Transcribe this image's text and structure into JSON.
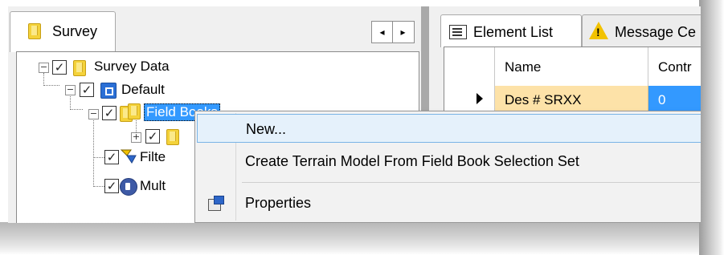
{
  "survey_panel": {
    "tab_label": "Survey",
    "scroll_left": "◂",
    "scroll_right": "▸",
    "tree": {
      "survey_data": "Survey Data",
      "default": "Default",
      "field_books": "Field Books",
      "filters_partial": "Filte",
      "multi_partial": "Mult"
    }
  },
  "right_panel": {
    "tabs": {
      "element_list": "Element List",
      "message_center": "Message Ce"
    },
    "grid": {
      "columns": [
        "Name",
        "Contr"
      ],
      "rows": [
        {
          "name": "Des #  SRXX",
          "control": "0"
        }
      ]
    }
  },
  "context_menu": {
    "items": [
      {
        "label": "New..."
      },
      {
        "label": "Create Terrain Model From Field Book Selection Set"
      },
      {
        "label": "Properties"
      }
    ]
  },
  "colors": {
    "selection": "#3399ff",
    "menu_highlight": "#e5f1fb",
    "row_highlight": "#fde2a8",
    "warning": "#f2c200"
  }
}
